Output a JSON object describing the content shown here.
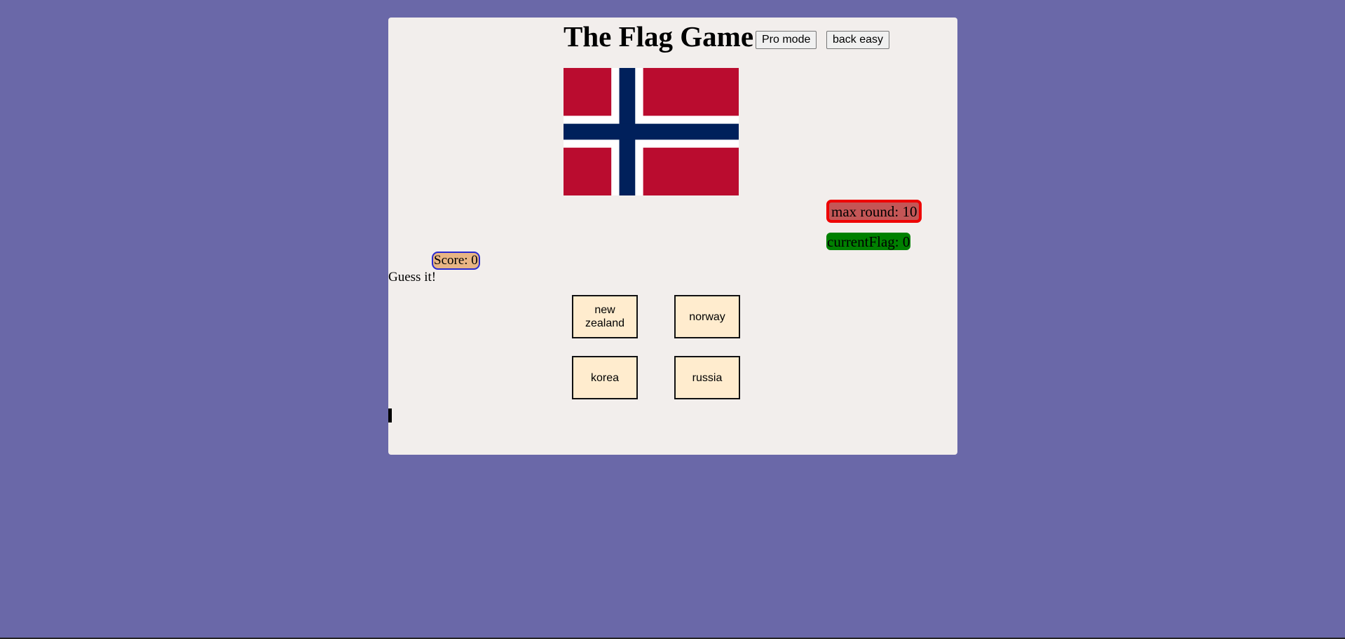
{
  "header": {
    "title": "The Flag Game",
    "pro_mode_label": "Pro mode",
    "back_easy_label": "back easy"
  },
  "flag": {
    "country_shown": "norway",
    "colors": {
      "red": "#ba0c2f",
      "white": "#ffffff",
      "blue": "#00205b"
    }
  },
  "status": {
    "max_round": "max round: 10",
    "current_flag": "currentFlag: 0",
    "score": "Score: 0"
  },
  "prompt": "Guess it!",
  "answers": [
    {
      "label": "new zealand"
    },
    {
      "label": "norway"
    },
    {
      "label": "korea"
    },
    {
      "label": "russia"
    }
  ],
  "colors": {
    "background": "#6a68a8",
    "panel": "#f2eeec",
    "answer_button": "#ffecce",
    "max_round_bg": "#c45656",
    "max_round_border": "#ee0000",
    "current_flag_bg": "#008000",
    "score_bg": "#e8b584",
    "score_border": "#2a2ad0"
  }
}
